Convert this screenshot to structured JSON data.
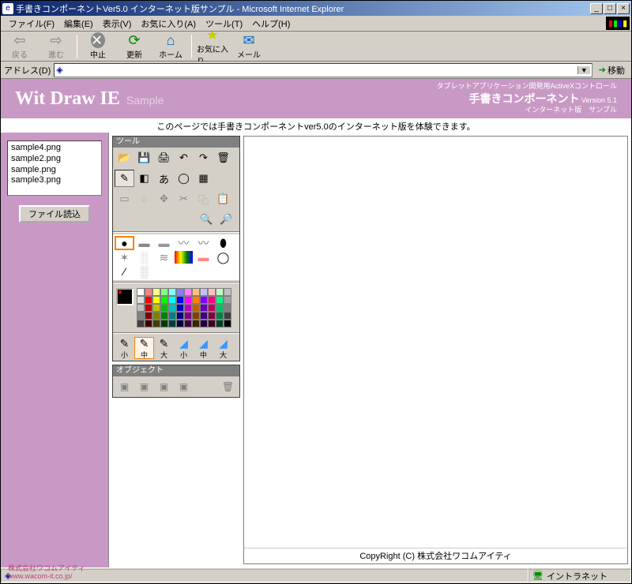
{
  "window": {
    "title": "手書きコンポーネントVer5.0 インターネット版サンプル - Microsoft Internet Explorer"
  },
  "menu": {
    "file": "ファイル(F)",
    "edit": "編集(E)",
    "view": "表示(V)",
    "fav": "お気に入り(A)",
    "tools": "ツール(T)",
    "help": "ヘルプ(H)"
  },
  "toolbar": {
    "back": "戻る",
    "forward": "進む",
    "stop": "中止",
    "refresh": "更新",
    "home": "ホーム",
    "favorites": "お気に入り",
    "mail": "メール"
  },
  "address": {
    "label": "アドレス(D)",
    "value": "",
    "go": "移動"
  },
  "banner": {
    "title": "Wit Draw IE",
    "sample": "Sample",
    "line1": "タブレットアプリケーション開発用ActiveXコントロール",
    "line2": "手書きコンポーネント",
    "ver": "Version 5.1",
    "line3": "インターネット版　サンプル"
  },
  "subhead": "このページでは手書きコンポーネントver5.0のインターネット版を体験できます。",
  "files": [
    "sample4.png",
    "sample2.png",
    "sample.png",
    "sample3.png"
  ],
  "file_load": "ファイル読込",
  "panel": {
    "tool": "ツール",
    "object": "オブジェクト"
  },
  "size": {
    "s": "小",
    "m": "中",
    "l": "大"
  },
  "copyright": "CopyRight (C) 株式会社ワコムアイティ",
  "logo": {
    "name": "株式会社ワコムアイティ",
    "url": "www.wacom-it.co.jp/"
  },
  "status": {
    "zone": "イントラネット"
  },
  "palette": [
    "#ffffff",
    "#ff8080",
    "#ffff80",
    "#80ff80",
    "#80ffff",
    "#8080ff",
    "#ff80ff",
    "#ffc080",
    "#c0c0ff",
    "#ffc0c0",
    "#c0ffc0",
    "#c0c0c0",
    "#e0e0e0",
    "#ff0000",
    "#ffff00",
    "#00ff00",
    "#00ffff",
    "#0000ff",
    "#ff00ff",
    "#ff8000",
    "#8000ff",
    "#ff0080",
    "#00ff80",
    "#a0a0a0",
    "#c0c0c0",
    "#c00000",
    "#c0c000",
    "#00c000",
    "#00c0c0",
    "#0000c0",
    "#c000c0",
    "#c06000",
    "#6000c0",
    "#c00060",
    "#00c060",
    "#808080",
    "#808080",
    "#800000",
    "#808000",
    "#008000",
    "#008080",
    "#000080",
    "#800080",
    "#804000",
    "#400080",
    "#800040",
    "#008040",
    "#404040",
    "#404040",
    "#400000",
    "#404000",
    "#004000",
    "#004040",
    "#000040",
    "#400040",
    "#402000",
    "#200040",
    "#400020",
    "#004020",
    "#000000"
  ]
}
